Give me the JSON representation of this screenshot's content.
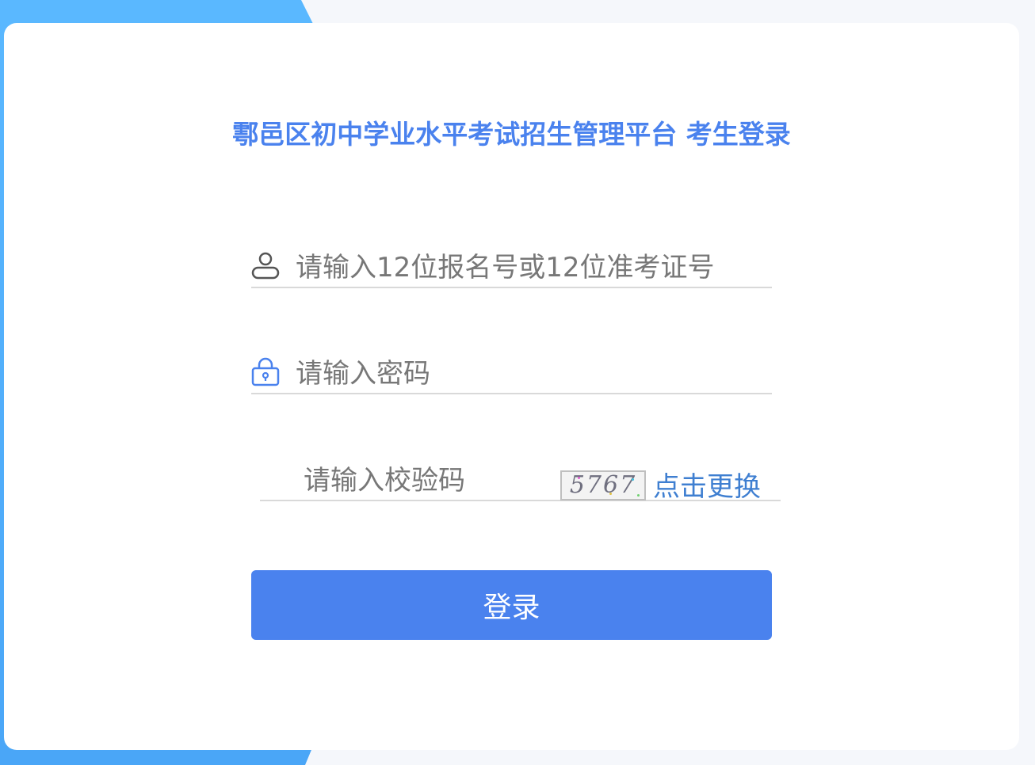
{
  "page": {
    "title": "鄠邑区初中学业水平考试招生管理平台 考生登录"
  },
  "form": {
    "username_placeholder": "请输入12位报名号或12位准考证号",
    "password_placeholder": "请输入密码",
    "captcha_placeholder": "请输入校验码",
    "captcha_text": "5767",
    "refresh_label": "点击更换",
    "login_label": "登录"
  },
  "icons": {
    "username": "user-icon",
    "password": "lock-icon"
  },
  "colors": {
    "accent": "#4a82ee",
    "link": "#3f7fd1",
    "sidebar": "#5ab8ff"
  }
}
